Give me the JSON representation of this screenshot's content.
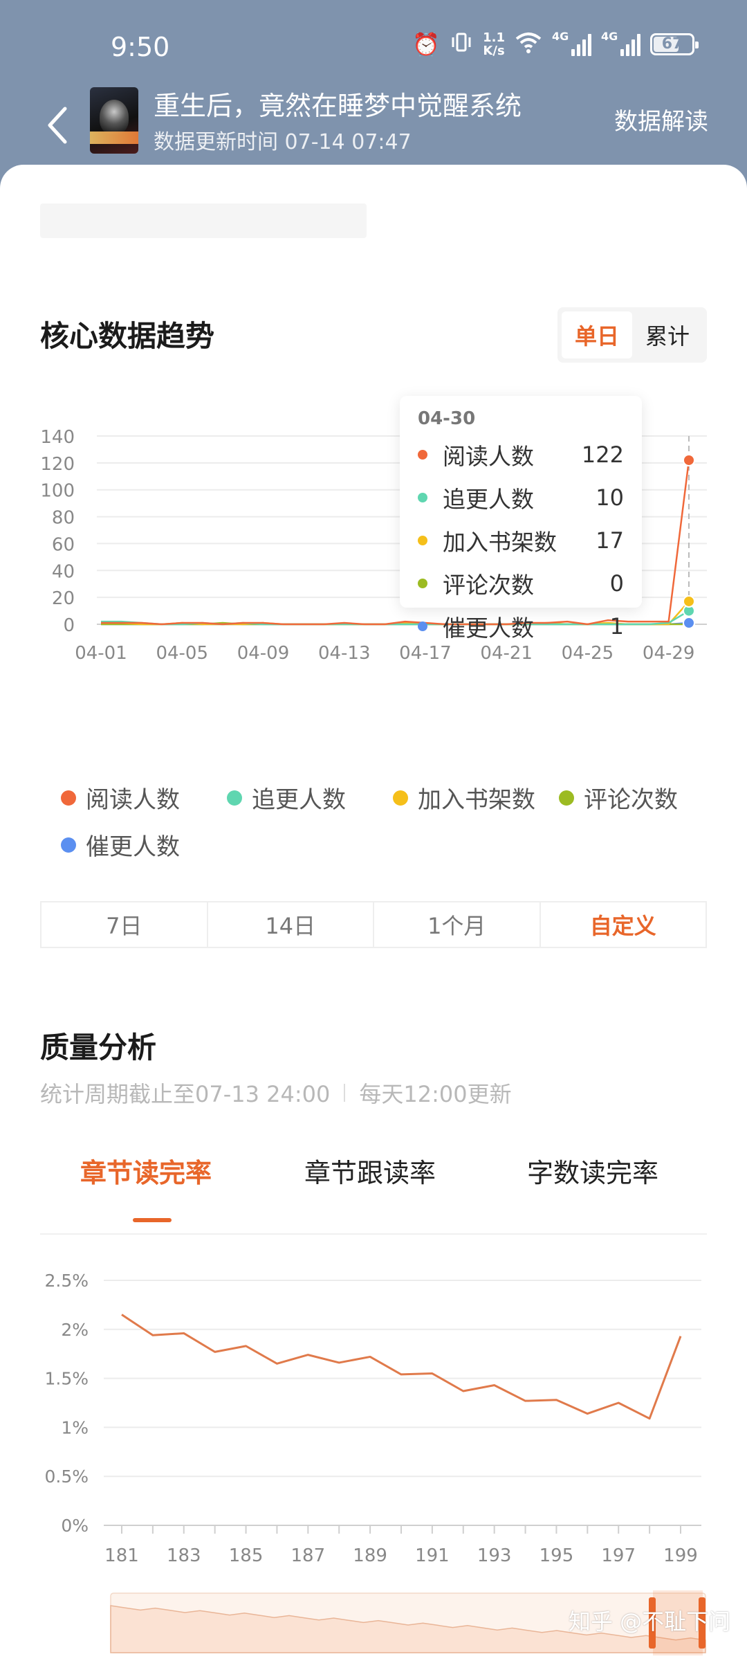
{
  "status_bar": {
    "time": "9:50",
    "net_speed_top": "1.1",
    "net_speed_bottom": "K/s",
    "signal1": "4G",
    "signal2": "4G",
    "battery": "67",
    "battery_level": 0.67
  },
  "header": {
    "book_title": "重生后，竟然在睡梦中觉醒系统",
    "update_time": "数据更新时间 07-14 07:47",
    "interpret_label": "数据解读"
  },
  "trend": {
    "title": "核心数据趋势",
    "toggle": [
      "单日",
      "累计"
    ],
    "active_toggle": 0,
    "tooltip": {
      "date": "04-30",
      "rows": [
        {
          "label": "阅读人数",
          "value": "122",
          "color": "#f0683a"
        },
        {
          "label": "追更人数",
          "value": "10",
          "color": "#5fd6b0"
        },
        {
          "label": "加入书架数",
          "value": "17",
          "color": "#f5bf1a"
        },
        {
          "label": "评论次数",
          "value": "0",
          "color": "#9cbb22"
        },
        {
          "label": "催更人数",
          "value": "1",
          "color": "#5b8ff0"
        }
      ]
    },
    "legend": [
      {
        "label": "阅读人数",
        "color": "#f0683a"
      },
      {
        "label": "追更人数",
        "color": "#5fd6b0"
      },
      {
        "label": "加入书架数",
        "color": "#f5bf1a"
      },
      {
        "label": "评论次数",
        "color": "#9cbb22"
      },
      {
        "label": "催更人数",
        "color": "#5b8ff0"
      }
    ],
    "range_tabs": [
      "7日",
      "14日",
      "1个月",
      "自定义"
    ],
    "active_range": 3
  },
  "quality": {
    "title": "质量分析",
    "period_note": "统计周期截止至07-13 24:00",
    "update_note": "每天12:00更新",
    "tabs": [
      "章节读完率",
      "章节跟读率",
      "字数读完率"
    ],
    "active_tab": 0
  },
  "watermark": "知乎 @不耻下问",
  "chart_data": [
    {
      "type": "line",
      "x": [
        "04-01",
        "04-02",
        "04-03",
        "04-04",
        "04-05",
        "04-06",
        "04-07",
        "04-08",
        "04-09",
        "04-10",
        "04-11",
        "04-12",
        "04-13",
        "04-14",
        "04-15",
        "04-16",
        "04-17",
        "04-18",
        "04-19",
        "04-20",
        "04-21",
        "04-22",
        "04-23",
        "04-24",
        "04-25",
        "04-26",
        "04-27",
        "04-28",
        "04-29",
        "04-30"
      ],
      "x_tick_labels": [
        "04-01",
        "04-05",
        "04-09",
        "04-13",
        "04-17",
        "04-21",
        "04-25",
        "04-29"
      ],
      "ylim": [
        0,
        140
      ],
      "y_ticks": [
        0,
        20,
        40,
        60,
        80,
        100,
        120,
        140
      ],
      "grid": true,
      "series": [
        {
          "name": "阅读人数",
          "color": "#f0683a",
          "values": [
            1,
            1,
            1,
            0,
            1,
            1,
            0,
            1,
            1,
            0,
            0,
            0,
            1,
            0,
            0,
            2,
            1,
            0,
            0,
            0,
            0,
            1,
            1,
            2,
            0,
            3,
            2,
            2,
            2,
            122
          ]
        },
        {
          "name": "追更人数",
          "color": "#5fd6b0",
          "values": [
            2,
            2,
            1,
            0,
            0,
            1,
            0,
            1,
            0,
            0,
            0,
            0,
            0,
            0,
            0,
            0,
            0,
            0,
            0,
            0,
            0,
            0,
            0,
            0,
            0,
            0,
            0,
            0,
            1,
            10
          ]
        },
        {
          "name": "加入书架数",
          "color": "#f5bf1a",
          "values": [
            1,
            1,
            0,
            0,
            1,
            0,
            0,
            0,
            1,
            0,
            0,
            0,
            0,
            0,
            0,
            1,
            0,
            0,
            0,
            0,
            0,
            0,
            1,
            0,
            0,
            1,
            0,
            0,
            0,
            17
          ]
        },
        {
          "name": "评论次数",
          "color": "#9cbb22",
          "values": [
            0,
            0,
            0,
            0,
            0,
            0,
            1,
            0,
            0,
            0,
            0,
            0,
            0,
            0,
            0,
            0,
            0,
            0,
            0,
            0,
            0,
            0,
            0,
            0,
            0,
            0,
            0,
            0,
            0,
            0
          ]
        },
        {
          "name": "催更人数",
          "color": "#5b8ff0",
          "values": [
            0,
            0,
            0,
            0,
            0,
            0,
            0,
            0,
            0,
            0,
            0,
            0,
            0,
            0,
            0,
            0,
            0,
            0,
            0,
            0,
            0,
            0,
            0,
            0,
            0,
            0,
            0,
            0,
            0,
            1
          ]
        }
      ],
      "highlight_index": 29
    },
    {
      "type": "line",
      "x": [
        181,
        182,
        183,
        184,
        185,
        186,
        187,
        188,
        189,
        190,
        191,
        192,
        193,
        194,
        195,
        196,
        197,
        198,
        199
      ],
      "x_tick_labels": [
        "181",
        "183",
        "185",
        "187",
        "189",
        "191",
        "193",
        "195",
        "197",
        "199"
      ],
      "y_tick_labels": [
        "0%",
        "0.5%",
        "1%",
        "1.5%",
        "2%",
        "2.5%"
      ],
      "ylim": [
        0,
        2.5
      ],
      "grid": true,
      "series": [
        {
          "name": "章节读完率",
          "color": "#e07a4b",
          "values": [
            2.15,
            1.94,
            1.96,
            1.77,
            1.83,
            1.65,
            1.74,
            1.66,
            1.72,
            1.54,
            1.55,
            1.37,
            1.43,
            1.27,
            1.28,
            1.14,
            1.25,
            1.09,
            1.93
          ]
        }
      ]
    }
  ]
}
